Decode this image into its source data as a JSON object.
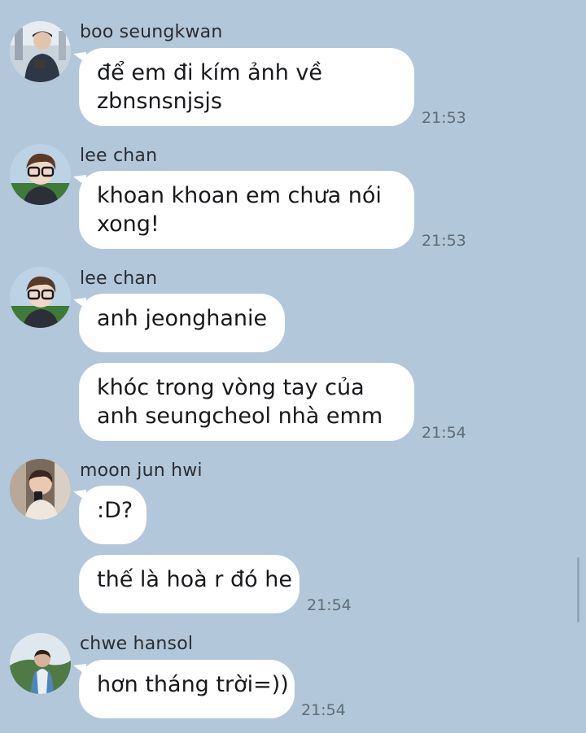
{
  "messages": [
    {
      "sender": "boo seungkwan",
      "lines": [
        "để em đi kím ảnh về",
        "zbnsnsnjsjs"
      ],
      "time": "21:53"
    },
    {
      "sender": "lee chan",
      "lines": [
        "khoan khoan em chưa nói",
        "xong!"
      ],
      "time": "21:53"
    },
    {
      "sender": "lee chan",
      "lines": [
        "anh jeonghanie"
      ]
    },
    {
      "lines": [
        "khóc trong vòng tay của",
        "anh seungcheol nhà emm"
      ],
      "time": "21:54"
    },
    {
      "sender": "moon jun hwi",
      "lines": [
        ":D?"
      ]
    },
    {
      "lines": [
        "thế là hoà r đó he"
      ],
      "time": "21:54"
    },
    {
      "sender": "chwe hansol",
      "lines": [
        "hơn tháng trời=))"
      ],
      "time": "21:54"
    }
  ],
  "colors": {
    "background": "#b2c7d9",
    "bubble": "#ffffff",
    "timestamp": "#5f6b76"
  }
}
